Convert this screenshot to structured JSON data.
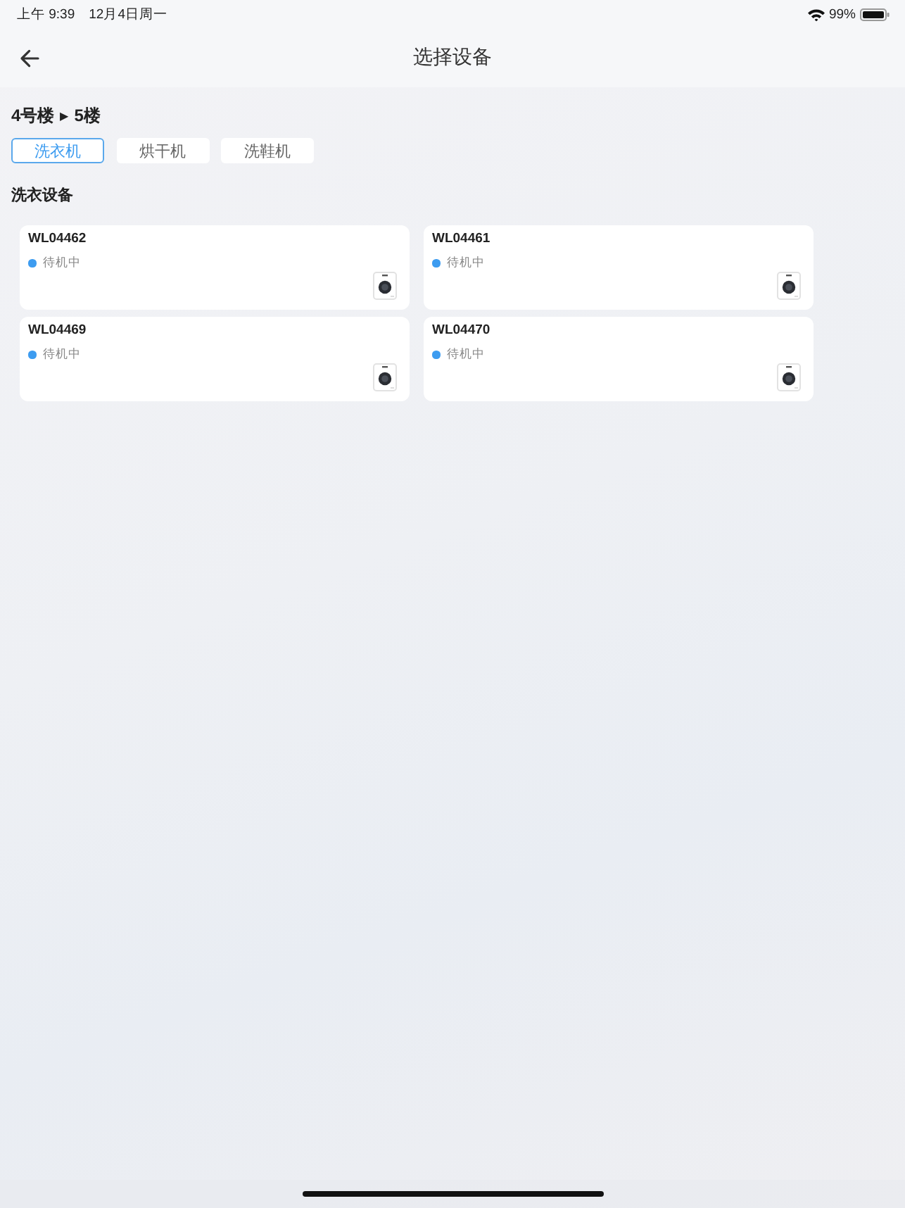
{
  "status_bar": {
    "time": "上午 9:39",
    "date": "12月4日周一",
    "battery_percent": "99%"
  },
  "nav_bar": {
    "title": "选择设备"
  },
  "breadcrumb": {
    "building": "4号楼",
    "separator": "▶",
    "floor": "5楼"
  },
  "tabs": [
    {
      "label": "洗衣机",
      "selected": true
    },
    {
      "label": "烘干机",
      "selected": false
    },
    {
      "label": "洗鞋机",
      "selected": false
    }
  ],
  "section": {
    "title": "洗衣设备",
    "devices": [
      {
        "name": "WL04462",
        "status": "待机中",
        "color": "#3d9cf0"
      },
      {
        "name": "WL04461",
        "status": "待机中",
        "color": "#3d9cf0"
      },
      {
        "name": "WL04469",
        "status": "待机中",
        "color": "#3d9cf0"
      },
      {
        "name": "WL04470",
        "status": "待机中",
        "color": "#3d9cf0"
      }
    ]
  }
}
